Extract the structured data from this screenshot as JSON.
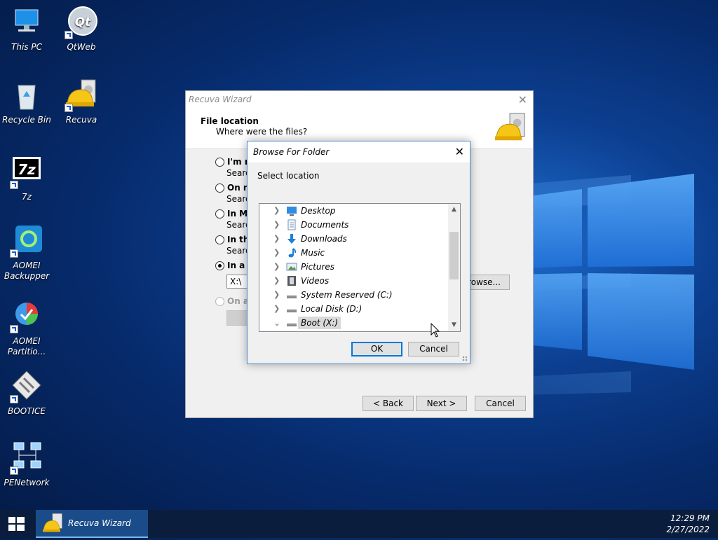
{
  "desktop": {
    "icons": [
      {
        "label": "This PC"
      },
      {
        "label": "QtWeb"
      },
      {
        "label": "Recycle Bin"
      },
      {
        "label": "Recuva"
      },
      {
        "label": "7z"
      },
      {
        "label": "AOMEI Backupper"
      },
      {
        "label": "AOMEI Partitio..."
      },
      {
        "label": "BOOTICE"
      },
      {
        "label": "PENetwork"
      }
    ]
  },
  "wizard": {
    "title": "Recuva Wizard",
    "header_title": "File location",
    "header_subtitle": "Where were the files?",
    "options": [
      {
        "label": "I'm n",
        "sub": "Search",
        "selected": false
      },
      {
        "label": "On m",
        "sub": "Search",
        "selected": false
      },
      {
        "label": "In My",
        "sub": "Search",
        "selected": false
      },
      {
        "label": "In the",
        "sub": "Search",
        "selected": false
      },
      {
        "label": "In a s",
        "selected": true
      },
      {
        "label": "On a",
        "selected": false,
        "disabled": true
      }
    ],
    "path_value": "X:\\",
    "browse_label": "rowse...",
    "back_label": "< Back",
    "next_label": "Next >",
    "cancel_label": "Cancel"
  },
  "browse_dialog": {
    "title": "Browse For Folder",
    "instruction": "Select location",
    "tree_items": [
      {
        "label": "Desktop",
        "icon": "desktop-icon",
        "expanded": false
      },
      {
        "label": "Documents",
        "icon": "documents-icon",
        "expanded": false
      },
      {
        "label": "Downloads",
        "icon": "downloads-icon",
        "expanded": false
      },
      {
        "label": "Music",
        "icon": "music-icon",
        "expanded": false
      },
      {
        "label": "Pictures",
        "icon": "pictures-icon",
        "expanded": false
      },
      {
        "label": "Videos",
        "icon": "videos-icon",
        "expanded": false
      },
      {
        "label": "System Reserved (C:)",
        "icon": "drive-icon",
        "expanded": false
      },
      {
        "label": "Local Disk (D:)",
        "icon": "drive-icon",
        "expanded": false
      },
      {
        "label": "Boot (X:)",
        "icon": "drive-icon",
        "expanded": true,
        "selected": true
      }
    ],
    "ok_label": "OK",
    "cancel_label": "Cancel"
  },
  "taskbar": {
    "active_task": "Recuva Wizard",
    "time": "12:29 PM",
    "date": "2/27/2022"
  },
  "colors": {
    "accent": "#0078d7",
    "taskbar": "#0b1d3d",
    "desktop_blue": "#0c3f91"
  }
}
